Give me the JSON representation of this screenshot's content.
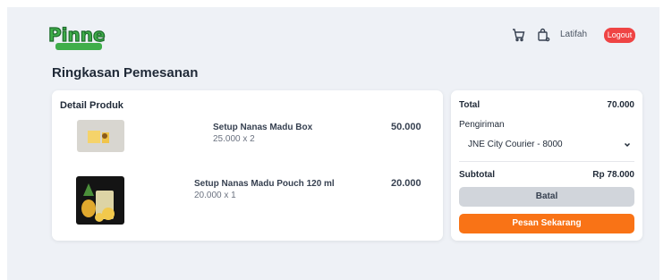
{
  "header": {
    "logo_text": "Pinne",
    "user_name": "Latifah",
    "logout_label": "Logout",
    "cart_icon": "cart-icon",
    "bag_icon": "bag-icon"
  },
  "page_title": "Ringkasan Pemesanan",
  "products": {
    "title": "Detail Produk",
    "items": [
      {
        "name": "Setup Nanas Madu Box",
        "qty": "25.000 x 2",
        "price": "50.000"
      },
      {
        "name": "Setup Nanas Madu Pouch 120 ml",
        "qty": "20.000 x 1",
        "price": "20.000"
      }
    ]
  },
  "summary": {
    "total_label": "Total",
    "total_value": "70.000",
    "shipping_label": "Pengiriman",
    "shipping_selected": "JNE City Courier - 8000",
    "subtotal_label": "Subtotal",
    "subtotal_value": "Rp 78.000",
    "cancel_label": "Batal",
    "order_label": "Pesan Sekarang"
  },
  "colors": {
    "accent": "#f97316",
    "logout": "#ef4444",
    "logo_green": "#3fae4a",
    "background": "#eef1f6"
  }
}
